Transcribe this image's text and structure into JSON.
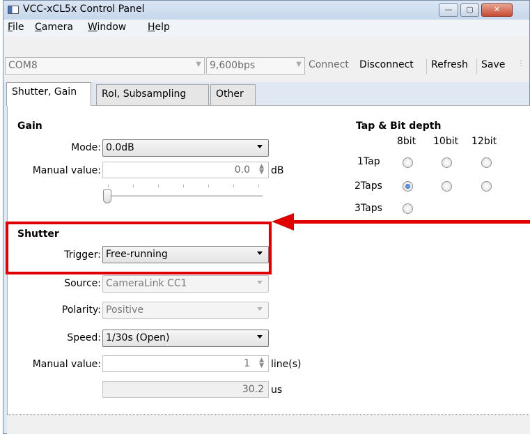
{
  "window": {
    "title": "VCC-xCL5x Control Panel",
    "close_symbol": "✕",
    "min_symbol": "—",
    "max_symbol": "▢"
  },
  "menu": {
    "items": [
      {
        "first": "F",
        "rest": "ile"
      },
      {
        "first": "C",
        "rest": "amera"
      },
      {
        "first": "W",
        "rest": "indow"
      },
      {
        "first": "H",
        "rest": "elp"
      }
    ]
  },
  "toolbar": {
    "port": "COM8",
    "baud": "9,600bps",
    "connect": "Connect",
    "disconnect": "Disconnect",
    "refresh": "Refresh",
    "save": "Save"
  },
  "tabs": [
    "Shutter, Gain",
    "RoI, Subsampling",
    "Other"
  ],
  "gain": {
    "title": "Gain",
    "mode_label": "Mode:",
    "mode_value": "0.0dB",
    "manual_label": "Manual value:",
    "manual_value": "0.0",
    "unit": "dB",
    "slider_position": 0
  },
  "tap": {
    "title": "Tap & Bit depth",
    "columns": [
      "8bit",
      "10bit",
      "12bit"
    ],
    "rows": [
      "1Tap",
      "2Taps",
      "3Taps"
    ],
    "selected": {
      "row": "2Taps",
      "column": "8bit"
    }
  },
  "shutter": {
    "title": "Shutter",
    "trigger_label": "Trigger:",
    "trigger_value": "Free-running",
    "source_label": "Source:",
    "source_value": "CameraLink CC1",
    "polarity_label": "Polarity:",
    "polarity_value": "Positive",
    "speed_label": "Speed:",
    "speed_value": "1/30s (Open)",
    "manual_label": "Manual value:",
    "manual_value": "1",
    "manual_unit": "line(s)",
    "time_value": "30.2",
    "time_unit": "us"
  },
  "colors": {
    "highlight": "#e00000",
    "radio_selected": "#1a4fa6"
  }
}
